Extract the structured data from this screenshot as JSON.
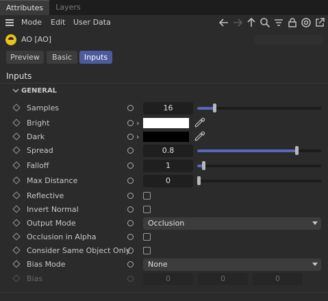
{
  "tabs": [
    "Attributes",
    "Layers"
  ],
  "menu": [
    "Mode",
    "Edit",
    "User Data"
  ],
  "toolbar_icons": [
    "arrow-left-icon",
    "arrow-right-icon",
    "arrow-up-icon",
    "search-icon",
    "filter-icon",
    "lock-icon",
    "target-icon",
    "new-window-icon"
  ],
  "object": {
    "name": "AO [AO]",
    "icon": "ao-shader-icon"
  },
  "page_tabs": [
    "Preview",
    "Basic",
    "Inputs"
  ],
  "selected_tab": "Inputs",
  "section_title": "Inputs",
  "group_label": "GENERAL",
  "params": {
    "samples": {
      "label": "Samples",
      "value": "16",
      "slider_fraction": 0.14
    },
    "bright": {
      "label": "Bright",
      "color": "#ffffff"
    },
    "dark": {
      "label": "Dark",
      "color": "#000000"
    },
    "spread": {
      "label": "Spread",
      "value": "0.8",
      "slider_fraction": 0.8
    },
    "falloff": {
      "label": "Falloff",
      "value": "1",
      "slider_fraction": 0.05
    },
    "max_distance": {
      "label": "Max Distance",
      "value": "0",
      "slider_fraction": 0.0
    },
    "reflective": {
      "label": "Reflective",
      "checked": false
    },
    "invert_normal": {
      "label": "Invert Normal",
      "checked": false
    },
    "output_mode": {
      "label": "Output Mode",
      "value": "Occlusion"
    },
    "occlusion_in_alpha": {
      "label": "Occlusion in Alpha",
      "checked": false
    },
    "consider_same_object_only": {
      "label": "Consider Same Object Only",
      "checked": false
    },
    "bias_mode": {
      "label": "Bias Mode",
      "value": "None"
    },
    "bias": {
      "label": "Bias",
      "x": "0",
      "y": "0",
      "z": "0"
    }
  },
  "colors": {
    "accent": "#5a67b8",
    "selected_tab": "#4d5b9e",
    "object_icon": "#e8c31a"
  }
}
